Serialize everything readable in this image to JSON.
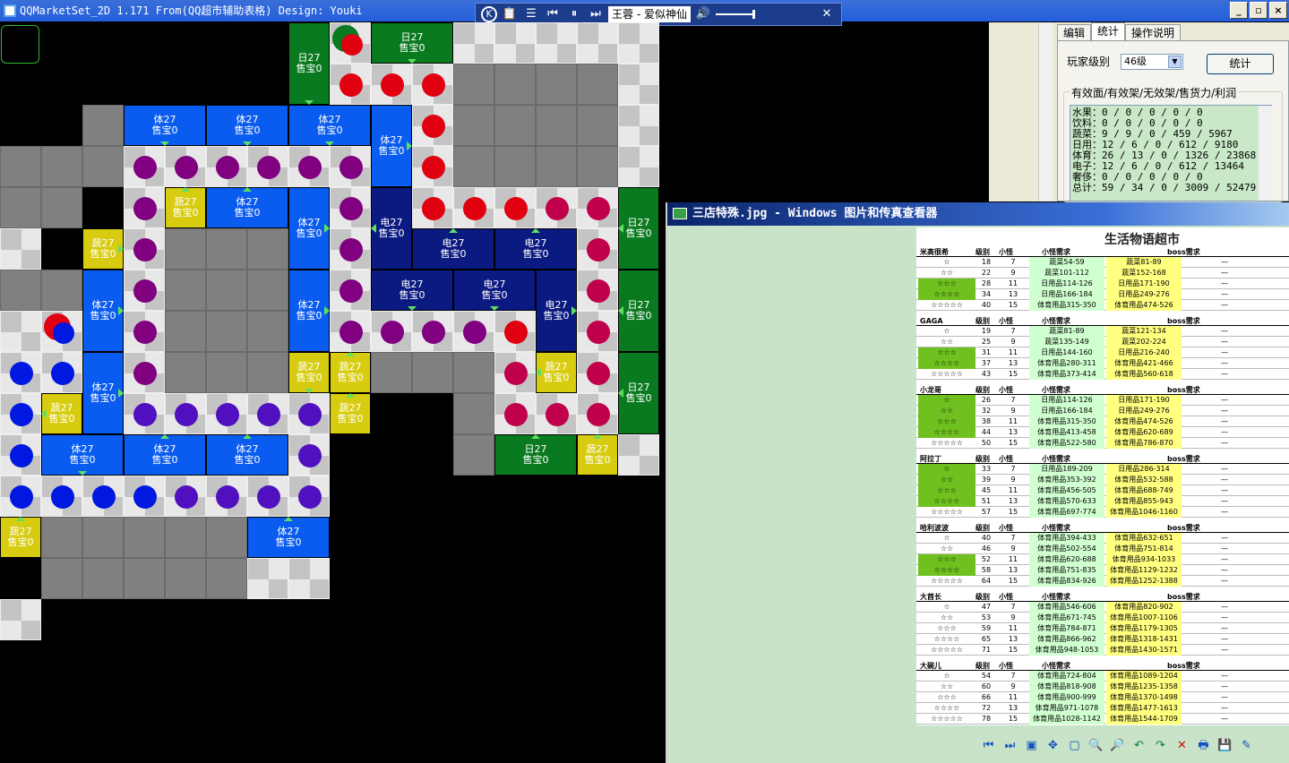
{
  "app": {
    "title": "QQMarketSet_2D  1.171 From(QQ超市辅助表格)  Design: Youki",
    "minimize": "_",
    "maximize": "▫",
    "close": "×"
  },
  "player": {
    "logo": "K",
    "song": "王蓉 - 爱似神仙",
    "buttons": [
      "📋",
      "☰",
      "⏮",
      "⏸",
      "⏭"
    ],
    "volume_icon": "🔊",
    "close": "✕"
  },
  "board": {
    "shelf_sale": "售宝0",
    "shelves": [
      {
        "id": "s1",
        "type": "日27",
        "color": "green",
        "arrow": "d"
      },
      {
        "id": "s2",
        "type": "日27",
        "color": "green",
        "arrow": "d"
      },
      {
        "id": "s3",
        "type": "体27",
        "color": "blue",
        "arrow": "d"
      },
      {
        "id": "s4",
        "type": "体27",
        "color": "blue",
        "arrow": "d"
      },
      {
        "id": "s5",
        "type": "体27",
        "color": "blue",
        "arrow": "d"
      },
      {
        "id": "s6",
        "type": "体27",
        "color": "blue",
        "arrow": "r"
      },
      {
        "id": "s7",
        "type": "蔬27",
        "color": "yellow",
        "arrow": "u"
      },
      {
        "id": "s8",
        "type": "体27",
        "color": "blue",
        "arrow": "u"
      },
      {
        "id": "s9",
        "type": "体27",
        "color": "blue",
        "arrow": "r"
      },
      {
        "id": "s10",
        "type": "电27",
        "color": "navy",
        "arrow": "l"
      },
      {
        "id": "s11",
        "type": "日27",
        "color": "green",
        "arrow": "l"
      },
      {
        "id": "s12",
        "type": "蔬27",
        "color": "yellow",
        "arrow": "r"
      },
      {
        "id": "s13",
        "type": "电27",
        "color": "navy",
        "arrow": "u"
      },
      {
        "id": "s14",
        "type": "电27",
        "color": "navy",
        "arrow": "u"
      },
      {
        "id": "s15",
        "type": "体27",
        "color": "blue",
        "arrow": "r"
      },
      {
        "id": "s16",
        "type": "体27",
        "color": "blue",
        "arrow": "r"
      },
      {
        "id": "s17",
        "type": "电27",
        "color": "navy",
        "arrow": "d"
      },
      {
        "id": "s18",
        "type": "电27",
        "color": "navy",
        "arrow": "d"
      },
      {
        "id": "s19",
        "type": "电27",
        "color": "navy",
        "arrow": "r"
      },
      {
        "id": "s20",
        "type": "日27",
        "color": "green",
        "arrow": "l"
      },
      {
        "id": "s21",
        "type": "蔬27",
        "color": "yellow",
        "arrow": "d"
      },
      {
        "id": "s22",
        "type": "蔬27",
        "color": "yellow",
        "arrow": "u"
      },
      {
        "id": "s23",
        "type": "蔬27",
        "color": "yellow",
        "arrow": "l"
      },
      {
        "id": "s24",
        "type": "体27",
        "color": "blue",
        "arrow": "r"
      },
      {
        "id": "s25",
        "type": "日27",
        "color": "green",
        "arrow": "l"
      },
      {
        "id": "s26",
        "type": "蔬27",
        "color": "yellow",
        "arrow": "l"
      },
      {
        "id": "s27",
        "type": "蔬27",
        "color": "yellow",
        "arrow": "u"
      },
      {
        "id": "s28",
        "type": "体27",
        "color": "blue",
        "arrow": "d"
      },
      {
        "id": "s29",
        "type": "体27",
        "color": "blue",
        "arrow": "u"
      },
      {
        "id": "s30",
        "type": "体27",
        "color": "blue",
        "arrow": "u"
      },
      {
        "id": "s31",
        "type": "日27",
        "color": "green",
        "arrow": "u"
      },
      {
        "id": "s32",
        "type": "蔬27",
        "color": "yellow",
        "arrow": "u"
      },
      {
        "id": "s33",
        "type": "蔬27",
        "color": "yellow",
        "arrow": "u"
      },
      {
        "id": "s34",
        "type": "体27",
        "color": "blue",
        "arrow": "u"
      }
    ],
    "colors": {
      "purple": "#800080",
      "red": "#e00010",
      "crimson": "#c0004a",
      "blue": "#0018e0",
      "violet": "#5010c0",
      "green": "#0a7a20",
      "navy": "#0a1a80",
      "shelf_blue": "#0a5cf0",
      "yellow": "#d8cc10"
    }
  },
  "panel": {
    "tabs": [
      "编辑",
      "统计",
      "操作说明"
    ],
    "active_tab": "统计",
    "level_label": "玩家级别",
    "level_value": "46级",
    "stat_button": "统计",
    "group_title": "有效面/有效架/无效架/售货力/利润",
    "stats": "水果：0 / 0 / 0 / 0 / 0\n饮料：0 / 0 / 0 / 0 / 0\n蔬菜：9 / 9 / 0 / 459 / 5967\n日用：12 / 6 / 0 / 612 / 9180\n体育：26 / 13 / 0 / 1326 / 23868\n电子：12 / 6 / 0 / 612 / 13464\n奢侈：0 / 0 / 0 / 0 / 0\n总计：59 / 34 / 0 / 3009 / 52479"
  },
  "viewer": {
    "title": "三店特殊.jpg - Windows 图片和传真查看器",
    "image_title": "生活物语超市",
    "col_level": "级别",
    "col_mon": "小怪",
    "col_req": "小怪需求",
    "col_boss": "boss需求",
    "sections": [
      {
        "name": "米高很希",
        "rows": [
          [
            "☆",
            "18",
            "7",
            "蔬菜54-59",
            "蔬菜81-89"
          ],
          [
            "☆☆",
            "22",
            "9",
            "蔬菜101-112",
            "蔬菜152-168"
          ],
          [
            "☆☆☆",
            "28",
            "11",
            "日用品114-126",
            "日用品171-190"
          ],
          [
            "☆☆☆☆",
            "34",
            "13",
            "日用品166-184",
            "日用品249-276"
          ],
          [
            "☆☆☆☆☆",
            "40",
            "15",
            "体育用品315-350",
            "体育用品474-526"
          ]
        ]
      },
      {
        "name": "GAGA",
        "rows": [
          [
            "☆",
            "19",
            "7",
            "蔬菜81-89",
            "蔬菜121-134"
          ],
          [
            "☆☆",
            "25",
            "9",
            "蔬菜135-149",
            "蔬菜202-224"
          ],
          [
            "☆☆☆",
            "31",
            "11",
            "日用品144-160",
            "日用品216-240"
          ],
          [
            "☆☆☆☆",
            "37",
            "13",
            "体育用品280-311",
            "体育用品421-466"
          ],
          [
            "☆☆☆☆☆",
            "43",
            "15",
            "体育用品373-414",
            "体育用品560-618"
          ]
        ]
      },
      {
        "name": "小龙哥",
        "rows": [
          [
            "☆",
            "26",
            "7",
            "日用品114-126",
            "日用品171-190"
          ],
          [
            "☆☆",
            "32",
            "9",
            "日用品166-184",
            "日用品249-276"
          ],
          [
            "☆☆☆",
            "38",
            "11",
            "体育用品315-350",
            "体育用品474-526"
          ],
          [
            "☆☆☆☆",
            "44",
            "13",
            "体育用品413-458",
            "体育用品620-689"
          ],
          [
            "☆☆☆☆☆",
            "50",
            "15",
            "体育用品522-580",
            "体育用品786-870"
          ]
        ]
      },
      {
        "name": "阿拉丁",
        "rows": [
          [
            "☆",
            "33",
            "7",
            "日用品189-209",
            "日用品286-314"
          ],
          [
            "☆☆",
            "39",
            "9",
            "体育用品353-392",
            "体育用品532-588"
          ],
          [
            "☆☆☆",
            "45",
            "11",
            "体育用品456-505",
            "体育用品688-749"
          ],
          [
            "☆☆☆☆",
            "51",
            "13",
            "体育用品570-633",
            "体育用品855-943"
          ],
          [
            "☆☆☆☆☆",
            "57",
            "15",
            "体育用品697-774",
            "体育用品1046-1160"
          ]
        ]
      },
      {
        "name": "哈利波波",
        "rows": [
          [
            "☆",
            "40",
            "7",
            "体育用品394-433",
            "体育用品632-651"
          ],
          [
            "☆☆",
            "46",
            "9",
            "体育用品502-554",
            "体育用品751-814"
          ],
          [
            "☆☆☆",
            "52",
            "11",
            "体育用品620-688",
            "体育用品934-1033"
          ],
          [
            "☆☆☆☆",
            "58",
            "13",
            "体育用品751-835",
            "体育用品1129-1232"
          ],
          [
            "☆☆☆☆☆",
            "64",
            "15",
            "体育用品834-926",
            "体育用品1252-1388"
          ]
        ]
      },
      {
        "name": "大酋长",
        "rows": [
          [
            "☆",
            "47",
            "7",
            "体育用品546-606",
            "体育用品820-902"
          ],
          [
            "☆☆",
            "53",
            "9",
            "体育用品671-745",
            "体育用品1007-1106"
          ],
          [
            "☆☆☆",
            "59",
            "11",
            "体育用品784-871",
            "体育用品1179-1305"
          ],
          [
            "☆☆☆☆",
            "65",
            "13",
            "体育用品866-962",
            "体育用品1318-1431"
          ],
          [
            "☆☆☆☆☆",
            "71",
            "15",
            "体育用品948-1053",
            "体育用品1430-1571"
          ]
        ]
      },
      {
        "name": "大碗儿",
        "rows": [
          [
            "☆",
            "54",
            "7",
            "体育用品724-804",
            "体育用品1089-1204"
          ],
          [
            "☆☆",
            "60",
            "9",
            "体育用品818-908",
            "体育用品1235-1358"
          ],
          [
            "☆☆☆",
            "66",
            "11",
            "体育用品900-999",
            "体育用品1370-1498"
          ],
          [
            "☆☆☆☆",
            "72",
            "13",
            "体育用品971-1078",
            "体育用品1477-1613"
          ],
          [
            "☆☆☆☆☆",
            "78",
            "15",
            "体育用品1028-1142",
            "体育用品1544-1709"
          ]
        ]
      }
    ],
    "toolbar": [
      "⏮",
      "⏭",
      "▣",
      "✥",
      "▢",
      "🔍",
      "🔎",
      "↶",
      "↷",
      "✕",
      "🖶",
      "💾",
      "✎"
    ]
  }
}
